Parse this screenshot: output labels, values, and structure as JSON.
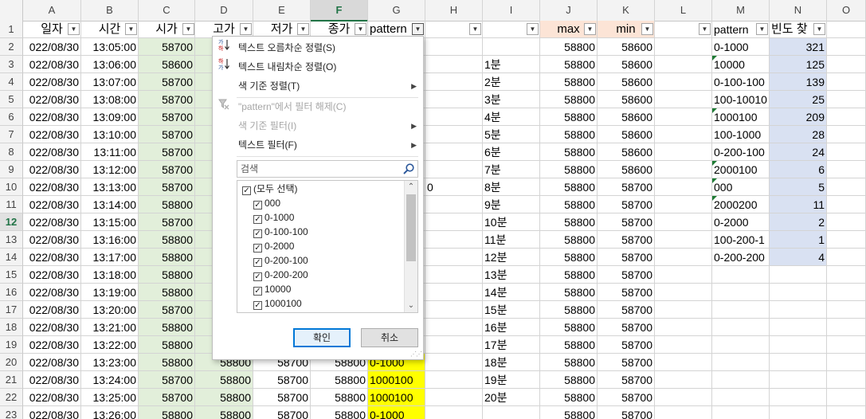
{
  "columns": [
    "A",
    "B",
    "C",
    "D",
    "E",
    "F",
    "G",
    "H",
    "I",
    "J",
    "K",
    "L",
    "M",
    "N",
    "O"
  ],
  "active_column": "F",
  "active_row": 12,
  "header_row": {
    "a": "일자",
    "b": "시간",
    "c": "시가",
    "d": "고가",
    "e": "저가",
    "f": "종가",
    "g": "pattern",
    "h": "",
    "i": "",
    "j": "max",
    "k": "min",
    "l": "",
    "m": "pattern",
    "n": "빈도 찾"
  },
  "rows": [
    {
      "num": "2",
      "a": "022/08/30",
      "b": "13:05:00",
      "c": "58700",
      "i": "",
      "j": "58800",
      "k": "58600",
      "m": "0-1000",
      "n": "321"
    },
    {
      "num": "3",
      "a": "022/08/30",
      "b": "13:06:00",
      "c": "58600",
      "i": "1분",
      "j": "58800",
      "k": "58600",
      "m": "10000",
      "n": "125"
    },
    {
      "num": "4",
      "a": "022/08/30",
      "b": "13:07:00",
      "c": "58700",
      "i": "2분",
      "j": "58800",
      "k": "58600",
      "m": "0-100-100",
      "n": "139"
    },
    {
      "num": "5",
      "a": "022/08/30",
      "b": "13:08:00",
      "c": "58700",
      "i": "3분",
      "j": "58800",
      "k": "58600",
      "m": "100-10010",
      "n": "25"
    },
    {
      "num": "6",
      "a": "022/08/30",
      "b": "13:09:00",
      "c": "58700",
      "i": "4분",
      "j": "58800",
      "k": "58600",
      "m": "1000100",
      "n": "209"
    },
    {
      "num": "7",
      "a": "022/08/30",
      "b": "13:10:00",
      "c": "58700",
      "i": "5분",
      "j": "58800",
      "k": "58600",
      "m": "100-1000",
      "n": "28"
    },
    {
      "num": "8",
      "a": "022/08/30",
      "b": "13:11:00",
      "c": "58700",
      "i": "6분",
      "j": "58800",
      "k": "58600",
      "m": "0-200-100",
      "n": "24"
    },
    {
      "num": "9",
      "a": "022/08/30",
      "b": "13:12:00",
      "c": "58700",
      "i": "7분",
      "j": "58800",
      "k": "58600",
      "m": "2000100",
      "n": "6"
    },
    {
      "num": "10",
      "a": "022/08/30",
      "b": "13:13:00",
      "c": "58700",
      "h": "0",
      "i": "8분",
      "j": "58800",
      "k": "58700",
      "m": "000",
      "n": "5"
    },
    {
      "num": "11",
      "a": "022/08/30",
      "b": "13:14:00",
      "c": "58800",
      "i": "9분",
      "j": "58800",
      "k": "58700",
      "m": "2000200",
      "n": "11"
    },
    {
      "num": "12",
      "a": "022/08/30",
      "b": "13:15:00",
      "c": "58700",
      "i": "10분",
      "j": "58800",
      "k": "58700",
      "m": "0-2000",
      "n": "2"
    },
    {
      "num": "13",
      "a": "022/08/30",
      "b": "13:16:00",
      "c": "58800",
      "i": "11분",
      "j": "58800",
      "k": "58700",
      "m": "100-200-1",
      "n": "1"
    },
    {
      "num": "14",
      "a": "022/08/30",
      "b": "13:17:00",
      "c": "58800",
      "i": "12분",
      "j": "58800",
      "k": "58700",
      "m": "0-200-200",
      "n": "4"
    },
    {
      "num": "15",
      "a": "022/08/30",
      "b": "13:18:00",
      "c": "58800",
      "i": "13분",
      "j": "58800",
      "k": "58700",
      "m": "",
      "n": ""
    },
    {
      "num": "16",
      "a": "022/08/30",
      "b": "13:19:00",
      "c": "58800",
      "i": "14분",
      "j": "58800",
      "k": "58700",
      "m": "",
      "n": ""
    },
    {
      "num": "17",
      "a": "022/08/30",
      "b": "13:20:00",
      "c": "58700",
      "i": "15분",
      "j": "58800",
      "k": "58700",
      "m": "",
      "n": ""
    },
    {
      "num": "18",
      "a": "022/08/30",
      "b": "13:21:00",
      "c": "58800",
      "i": "16분",
      "j": "58800",
      "k": "58700",
      "m": "",
      "n": ""
    },
    {
      "num": "19",
      "a": "022/08/30",
      "b": "13:22:00",
      "c": "58800",
      "i": "17분",
      "j": "58800",
      "k": "58700",
      "m": "",
      "n": ""
    },
    {
      "num": "20",
      "a": "022/08/30",
      "b": "13:23:00",
      "c": "58800",
      "d": "58800",
      "e": "58700",
      "f": "58800",
      "g": "0-1000",
      "i": "18분",
      "j": "58800",
      "k": "58700",
      "m": "",
      "n": ""
    },
    {
      "num": "21",
      "a": "022/08/30",
      "b": "13:24:00",
      "c": "58700",
      "d": "58800",
      "e": "58700",
      "f": "58800",
      "g": "1000100",
      "i": "19분",
      "j": "58800",
      "k": "58700",
      "m": "",
      "n": ""
    },
    {
      "num": "22",
      "a": "022/08/30",
      "b": "13:25:00",
      "c": "58700",
      "d": "58800",
      "e": "58700",
      "f": "58800",
      "g": "1000100",
      "i": "20분",
      "j": "58800",
      "k": "58700",
      "m": "",
      "n": ""
    },
    {
      "num": "23",
      "a": "022/08/30",
      "b": "13:26:00",
      "c": "58800",
      "d": "58800",
      "e": "58700",
      "f": "58800",
      "g": "0-1000",
      "i": "",
      "j": "58800",
      "k": "58700",
      "m": "",
      "n": ""
    }
  ],
  "filter_menu": {
    "sort_asc": "텍스트 오름차순 정렬(S)",
    "sort_desc": "텍스트 내림차순 정렬(O)",
    "sort_by_color": "색 기준 정렬(T)",
    "clear_filter": "\"pattern\"에서 필터 해제(C)",
    "filter_by_color": "색 기준 필터(I)",
    "text_filter": "텍스트 필터(F)",
    "search_placeholder": "검색",
    "items": [
      "(모두 선택)",
      "000",
      "0-1000",
      "0-100-100",
      "0-2000",
      "0-200-100",
      "0-200-200",
      "10000",
      "1000100"
    ],
    "ok": "확인",
    "cancel": "취소"
  },
  "colors": {
    "green_fill": "#e2efda",
    "yellow_fill": "#ffff00",
    "pink_fill": "#fce4d6",
    "blue_fill": "#d9e1f2",
    "accent": "#217346"
  }
}
